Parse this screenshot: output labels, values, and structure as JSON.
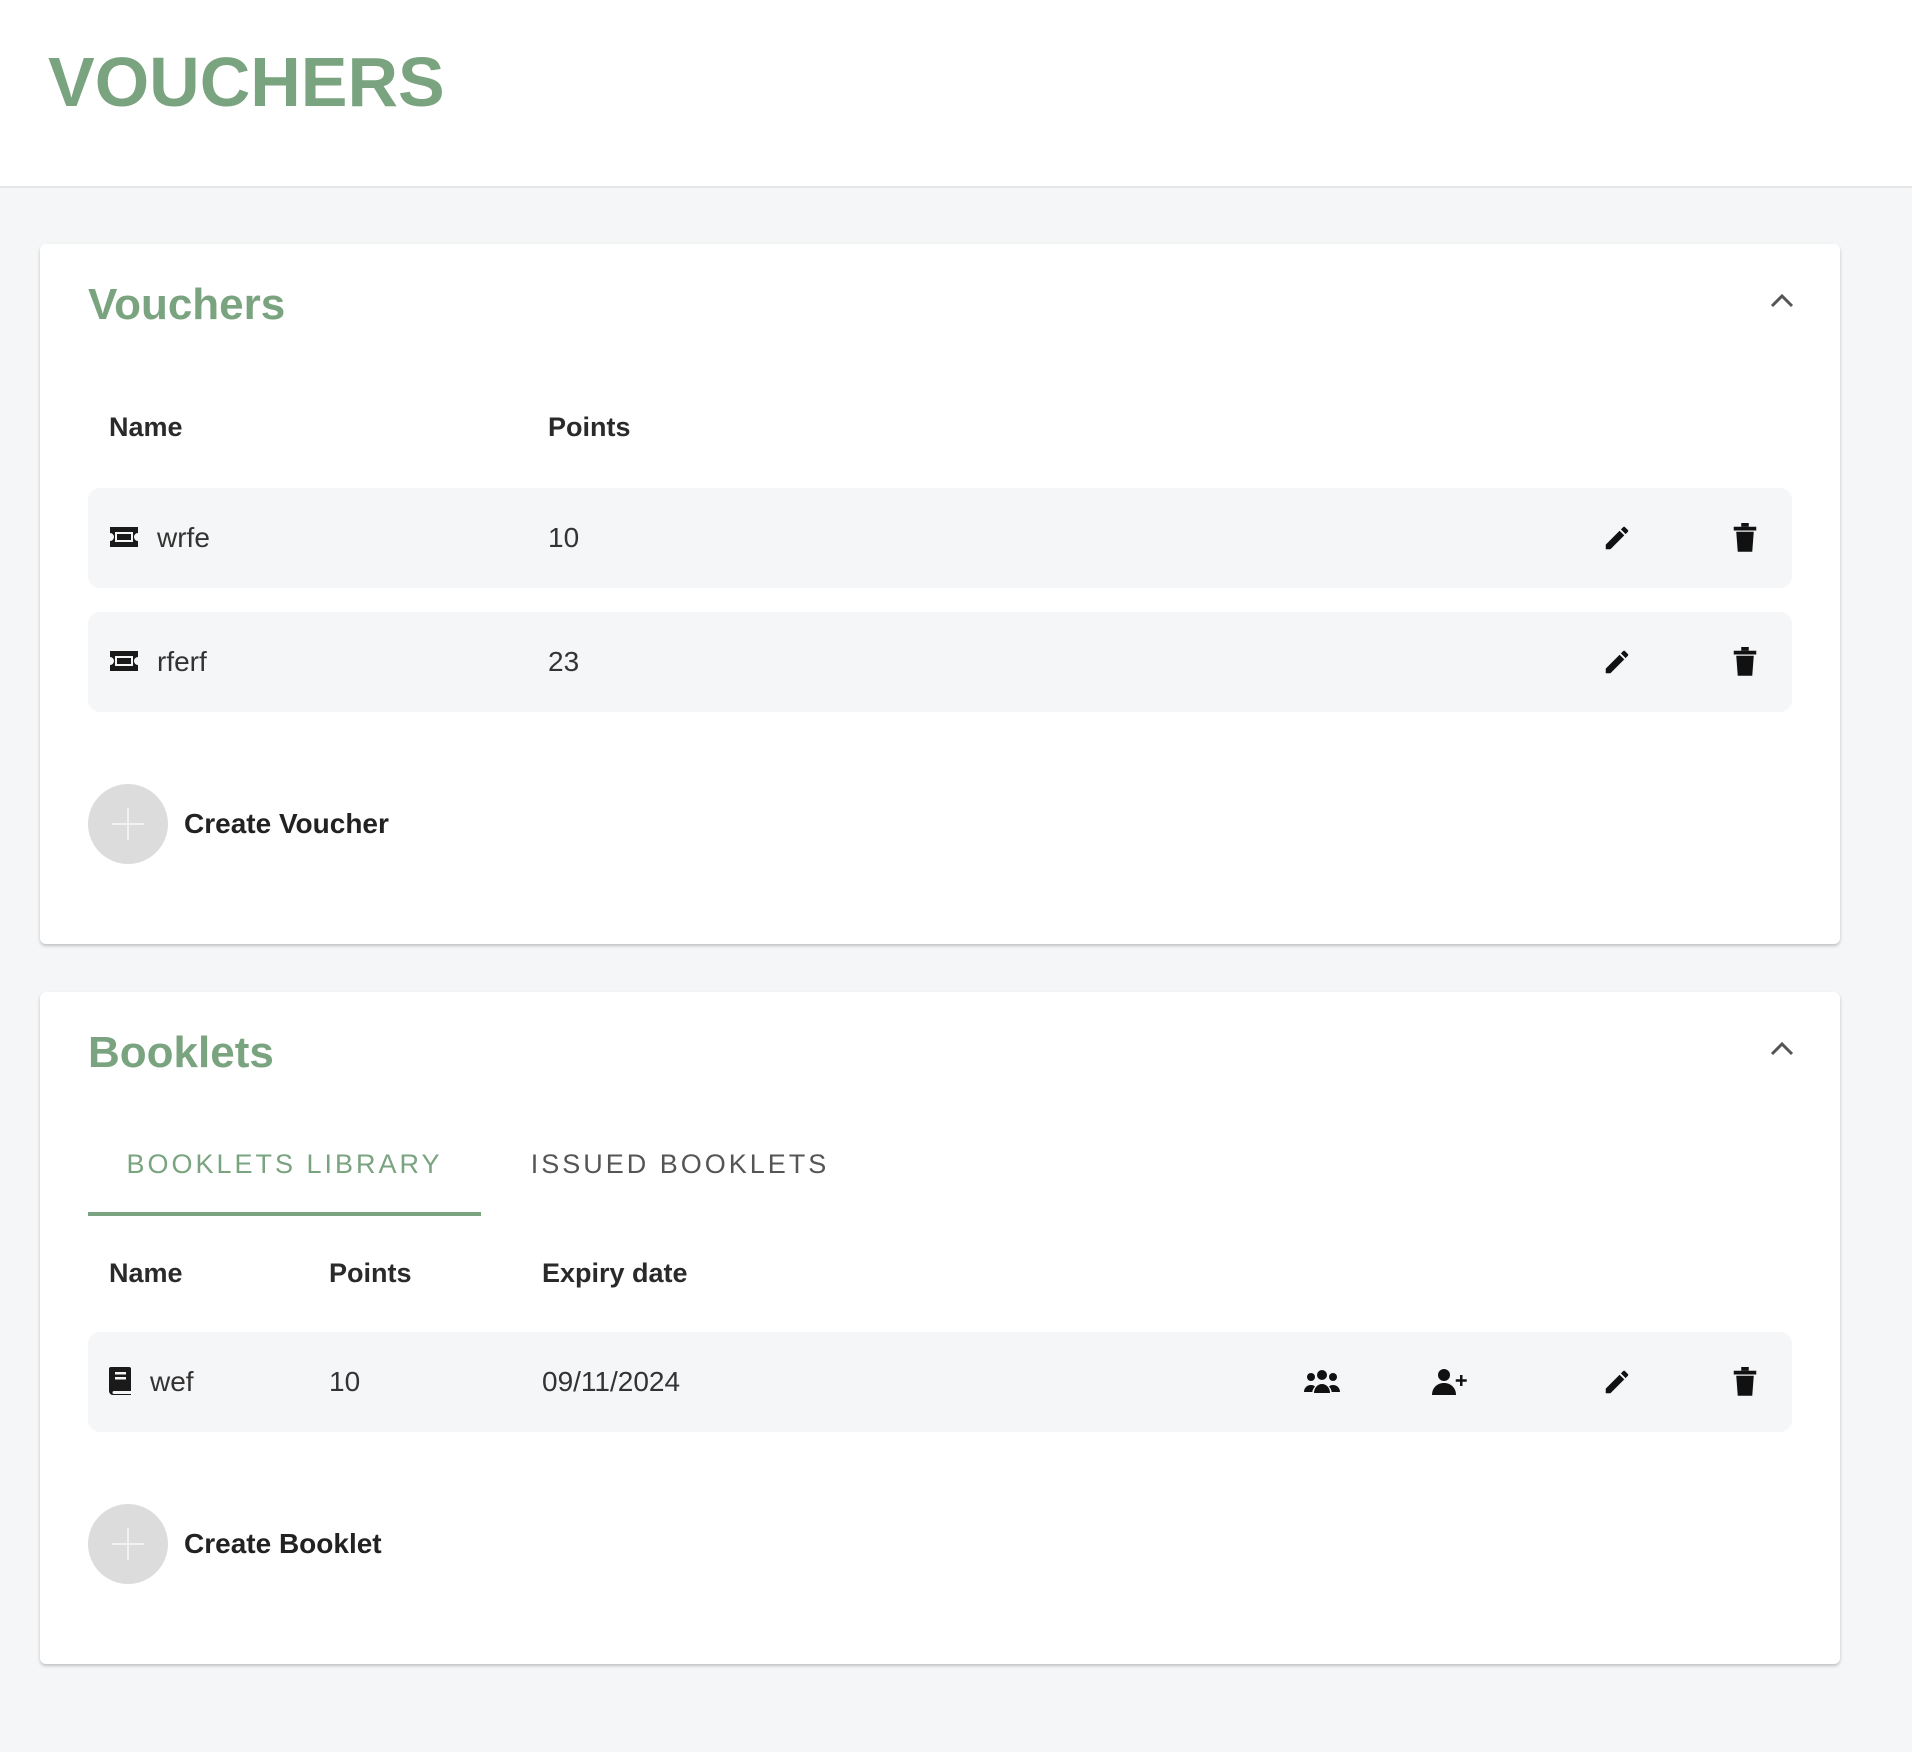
{
  "page": {
    "title": "VOUCHERS",
    "accent_color": "#7aa37f"
  },
  "vouchers": {
    "title": "Vouchers",
    "collapse_icon": "chevron-up-icon",
    "columns": {
      "name": "Name",
      "points": "Points"
    },
    "rows": [
      {
        "name": "wrfe",
        "points": "10",
        "icon": "ticket-icon"
      },
      {
        "name": "rferf",
        "points": "23",
        "icon": "ticket-icon"
      }
    ],
    "create_label": "Create Voucher"
  },
  "booklets": {
    "title": "Booklets",
    "collapse_icon": "chevron-up-icon",
    "tabs": [
      {
        "label": "BOOKLETS LIBRARY",
        "active": true
      },
      {
        "label": "ISSUED BOOKLETS",
        "active": false
      }
    ],
    "columns": {
      "name": "Name",
      "points": "Points",
      "expiry": "Expiry date"
    },
    "rows": [
      {
        "name": "wef",
        "points": "10",
        "expiry": "09/11/2024",
        "icon": "book-icon"
      }
    ],
    "create_label": "Create Booklet"
  }
}
